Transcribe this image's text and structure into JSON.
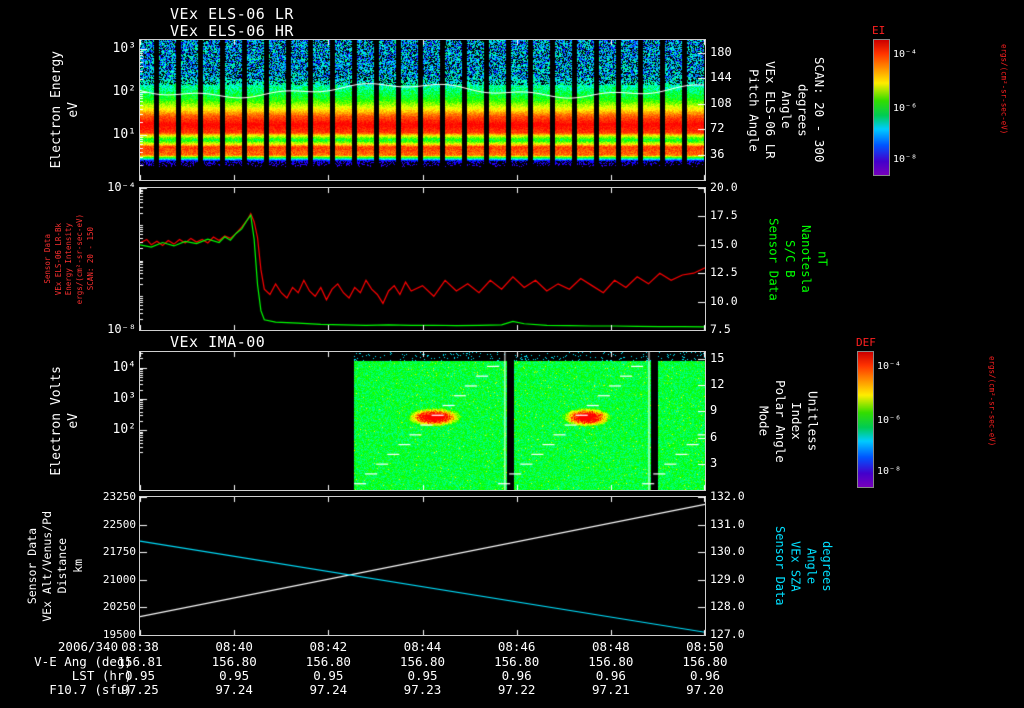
{
  "header": {
    "line1": "VEx ELS-06 LR",
    "line2": "VEx ELS-06 HR"
  },
  "panel3_title": "VEx IMA-00",
  "colors": {
    "background": "#000000",
    "axis": "#ffffff",
    "red_series": "#ff0000",
    "green_series": "#00ff00",
    "cyan_series": "#00e0ff",
    "white_series": "#ffffff",
    "colorbar_title": "#ff2020"
  },
  "time_axis": {
    "date": "2006/340",
    "ticks": [
      "08:38",
      "08:40",
      "08:42",
      "08:44",
      "08:46",
      "08:48",
      "08:50"
    ]
  },
  "footer_rows": [
    {
      "label": "V-E Ang (deg)",
      "values": [
        "156.81",
        "156.80",
        "156.80",
        "156.80",
        "156.80",
        "156.80",
        "156.80"
      ]
    },
    {
      "label": "LST (hr)",
      "values": [
        "0.95",
        "0.95",
        "0.95",
        "0.95",
        "0.96",
        "0.96",
        "0.96"
      ]
    },
    {
      "label": "F10.7 (sfu)",
      "values": [
        "97.25",
        "97.24",
        "97.24",
        "97.23",
        "97.22",
        "97.21",
        "97.20"
      ]
    }
  ],
  "colorbars": [
    {
      "title": "EI",
      "ticks": [
        "10⁻⁴",
        "10⁻⁶",
        "10⁻⁸"
      ],
      "unit": "ergs/(cm²-sr-sec-eV)"
    },
    {
      "title": "DEF",
      "ticks": [
        "10⁻⁴",
        "10⁻⁶",
        "10⁻⁸"
      ],
      "unit": "ergs/(cm²-sr-sec-eV)"
    }
  ],
  "chart_data": [
    {
      "type": "heatmap",
      "name": "els-electron-energy-spectrogram",
      "description": "VEx ELS-06 HR electron energy-time spectrogram 08:38-08:50, intense flux band ~10-60 eV, speckled low flux above 200 eV, regular telemetry gaps",
      "x_range": [
        "08:38",
        "08:50"
      ],
      "left_axis": {
        "label_lines": [
          "Electron Energy",
          "eV"
        ],
        "scale": "log",
        "min": -0.05,
        "max": 3.2,
        "ticks": [
          [
            3,
            "10³"
          ],
          [
            2,
            "10²"
          ],
          [
            1,
            "10¹"
          ]
        ],
        "color": "#ffffff"
      },
      "right_axis": {
        "label_lines": [
          "Pitch Angle",
          "VEx ELS-06 LR",
          "Angle",
          "degrees",
          "SCAN: 20 - 300"
        ],
        "min": 0,
        "max": 198,
        "ticks": [
          [
            180,
            "180"
          ],
          [
            144,
            "144"
          ],
          [
            108,
            "108"
          ],
          [
            72,
            "72"
          ],
          [
            36,
            "36"
          ]
        ],
        "color": "#ffffff"
      },
      "profile": [
        [
          0,
          0.25,
          0.6
        ],
        [
          0.26,
          0.28,
          0.55
        ],
        [
          0.34,
          0.42,
          0.35
        ],
        [
          0.42,
          0.55,
          0.25
        ],
        [
          0.48,
          0.75,
          0.15
        ],
        [
          0.54,
          0.92,
          0.1
        ],
        [
          0.6,
          1.0,
          0.08
        ],
        [
          0.66,
          0.95,
          0.1
        ],
        [
          0.71,
          0.5,
          0.3
        ],
        [
          0.76,
          0.95,
          0.12
        ],
        [
          0.82,
          0.9,
          0.15
        ],
        [
          0.86,
          0.05,
          0.2
        ],
        [
          0.92,
          0,
          0.05
        ],
        [
          1,
          0,
          0
        ]
      ],
      "gaps": {
        "period": 22,
        "width": 5,
        "offset": 8
      },
      "overlay_line": {
        "y_frac": 0.36,
        "color": "#ffffff"
      }
    },
    {
      "type": "line",
      "name": "els-intensity-and-magnetic-field",
      "left_axis": {
        "label_lines": [
          "Sensor Data",
          "VEx ELS-06 LR-Bk",
          "Energy Intensity",
          "ergs/(cm²-sr-sec-eV)",
          "SCAN: 20 - 150"
        ],
        "scale": "log",
        "min": -8,
        "max": -4,
        "ticks": [
          [
            -4,
            "10⁻⁴"
          ],
          [
            -8,
            "10⁻⁸"
          ]
        ],
        "color": "#ff3030"
      },
      "right_axis": {
        "label_lines": [
          "Sensor Data",
          "S/C B",
          "Nanotesla",
          "nT"
        ],
        "min": 7.5,
        "max": 20,
        "ticks": [
          [
            20,
            "20.0"
          ],
          [
            17.5,
            "17.5"
          ],
          [
            15,
            "15.0"
          ],
          [
            12.5,
            "12.5"
          ],
          [
            10,
            "10.0"
          ],
          [
            7.5,
            "7.5"
          ]
        ],
        "color": "#00ff00"
      },
      "series": [
        {
          "name": "energy-intensity-log10",
          "color": "#ff0000",
          "axis": "left",
          "points": [
            [
              0,
              -5.55
            ],
            [
              0.012,
              -5.45
            ],
            [
              0.02,
              -5.6
            ],
            [
              0.03,
              -5.5
            ],
            [
              0.04,
              -5.62
            ],
            [
              0.05,
              -5.48
            ],
            [
              0.06,
              -5.58
            ],
            [
              0.07,
              -5.45
            ],
            [
              0.08,
              -5.55
            ],
            [
              0.09,
              -5.42
            ],
            [
              0.1,
              -5.52
            ],
            [
              0.11,
              -5.45
            ],
            [
              0.12,
              -5.55
            ],
            [
              0.13,
              -5.38
            ],
            [
              0.14,
              -5.48
            ],
            [
              0.15,
              -5.35
            ],
            [
              0.16,
              -5.42
            ],
            [
              0.17,
              -5.28
            ],
            [
              0.18,
              -5.1
            ],
            [
              0.19,
              -4.9
            ],
            [
              0.196,
              -4.72
            ],
            [
              0.202,
              -4.95
            ],
            [
              0.208,
              -5.4
            ],
            [
              0.214,
              -6.3
            ],
            [
              0.22,
              -6.85
            ],
            [
              0.23,
              -7
            ],
            [
              0.24,
              -6.7
            ],
            [
              0.25,
              -6.95
            ],
            [
              0.26,
              -7.1
            ],
            [
              0.27,
              -6.8
            ],
            [
              0.28,
              -6.95
            ],
            [
              0.29,
              -6.6
            ],
            [
              0.3,
              -6.9
            ],
            [
              0.31,
              -7.05
            ],
            [
              0.32,
              -6.8
            ],
            [
              0.33,
              -7.15
            ],
            [
              0.34,
              -6.85
            ],
            [
              0.35,
              -6.7
            ],
            [
              0.36,
              -6.95
            ],
            [
              0.37,
              -7.1
            ],
            [
              0.38,
              -6.8
            ],
            [
              0.39,
              -6.95
            ],
            [
              0.4,
              -6.6
            ],
            [
              0.41,
              -6.85
            ],
            [
              0.42,
              -7
            ],
            [
              0.43,
              -7.25
            ],
            [
              0.44,
              -6.9
            ],
            [
              0.45,
              -6.75
            ],
            [
              0.46,
              -7
            ],
            [
              0.47,
              -6.65
            ],
            [
              0.48,
              -6.9
            ],
            [
              0.5,
              -6.75
            ],
            [
              0.52,
              -7.05
            ],
            [
              0.54,
              -6.6
            ],
            [
              0.56,
              -6.9
            ],
            [
              0.58,
              -6.7
            ],
            [
              0.6,
              -6.95
            ],
            [
              0.62,
              -6.6
            ],
            [
              0.64,
              -6.85
            ],
            [
              0.66,
              -6.5
            ],
            [
              0.68,
              -6.8
            ],
            [
              0.7,
              -6.6
            ],
            [
              0.72,
              -6.9
            ],
            [
              0.74,
              -6.7
            ],
            [
              0.76,
              -6.85
            ],
            [
              0.78,
              -6.55
            ],
            [
              0.8,
              -6.75
            ],
            [
              0.82,
              -6.95
            ],
            [
              0.84,
              -6.6
            ],
            [
              0.86,
              -6.8
            ],
            [
              0.88,
              -6.5
            ],
            [
              0.9,
              -6.7
            ],
            [
              0.92,
              -6.4
            ],
            [
              0.94,
              -6.6
            ],
            [
              0.96,
              -6.45
            ],
            [
              0.98,
              -6.4
            ],
            [
              1,
              -6.25
            ]
          ]
        },
        {
          "name": "sc-magnetic-field-nT",
          "color": "#00ff00",
          "axis": "right",
          "points": [
            [
              0,
              15
            ],
            [
              0.02,
              14.8
            ],
            [
              0.04,
              15.2
            ],
            [
              0.06,
              14.9
            ],
            [
              0.08,
              15.3
            ],
            [
              0.1,
              15.1
            ],
            [
              0.12,
              15.5
            ],
            [
              0.14,
              15.2
            ],
            [
              0.15,
              15.7
            ],
            [
              0.16,
              15.4
            ],
            [
              0.17,
              16
            ],
            [
              0.18,
              16.4
            ],
            [
              0.19,
              17.2
            ],
            [
              0.196,
              17.6
            ],
            [
              0.202,
              15.5
            ],
            [
              0.208,
              11.5
            ],
            [
              0.214,
              9.2
            ],
            [
              0.22,
              8.4
            ],
            [
              0.24,
              8.2
            ],
            [
              0.28,
              8.1
            ],
            [
              0.32,
              8
            ],
            [
              0.36,
              7.95
            ],
            [
              0.4,
              7.9
            ],
            [
              0.44,
              7.95
            ],
            [
              0.48,
              7.9
            ],
            [
              0.52,
              7.92
            ],
            [
              0.56,
              7.88
            ],
            [
              0.6,
              7.9
            ],
            [
              0.64,
              7.95
            ],
            [
              0.66,
              8.25
            ],
            [
              0.68,
              8.05
            ],
            [
              0.72,
              7.9
            ],
            [
              0.76,
              7.88
            ],
            [
              0.8,
              7.85
            ],
            [
              0.84,
              7.85
            ],
            [
              0.88,
              7.82
            ],
            [
              0.92,
              7.8
            ],
            [
              0.96,
              7.8
            ],
            [
              1,
              7.78
            ]
          ]
        }
      ]
    },
    {
      "type": "heatmap",
      "name": "ima-spectrogram",
      "description": "VEx IMA-00 ion spectrogram, data from ~08:42.5 onward, green background with two yellow-red hotspots and white stepped energy-sweep traces",
      "left_axis": {
        "label_lines": [
          "Electron Volts",
          "eV"
        ],
        "scale": "log",
        "min": 0.1,
        "max": 4.5,
        "ticks": [
          [
            4,
            "10⁴"
          ],
          [
            3,
            "10³"
          ],
          [
            2,
            "10²"
          ]
        ],
        "color": "#ffffff"
      },
      "right_axis": {
        "label_lines": [
          "Mode",
          "Polar Angle",
          "Index",
          "Unitless"
        ],
        "min": 0,
        "max": 15.8,
        "ticks": [
          [
            15,
            "15"
          ],
          [
            12,
            "12"
          ],
          [
            9,
            "9"
          ],
          [
            6,
            "6"
          ],
          [
            3,
            "3"
          ]
        ],
        "color": "#ffffff"
      },
      "data_start_frac": 0.38,
      "base_intensity": 0.5,
      "hotspots": [
        {
          "x": 0.52,
          "y": 0.47,
          "rx": 0.05,
          "ry": 0.07
        },
        {
          "x": 0.79,
          "y": 0.47,
          "rx": 0.045,
          "ry": 0.07
        }
      ],
      "sweep_lines": {
        "period_frac": 0.255,
        "y_top": 0.1,
        "y_bottom": 0.95,
        "color": "#ffffff"
      },
      "dividers": [
        0.645,
        0.9
      ]
    },
    {
      "type": "line",
      "name": "altitude-and-sza",
      "left_axis": {
        "label_lines": [
          "Sensor Data",
          "VEx Alt/Venus/Pd",
          "Distance",
          "km"
        ],
        "min": 19500,
        "max": 23250,
        "ticks": [
          [
            23250,
            "23250"
          ],
          [
            22500,
            "22500"
          ],
          [
            21750,
            "21750"
          ],
          [
            21000,
            "21000"
          ],
          [
            20250,
            "20250"
          ],
          [
            19500,
            "19500"
          ]
        ],
        "color": "#ffffff"
      },
      "right_axis": {
        "label_lines": [
          "Sensor Data",
          "VEx SZA",
          "Angle",
          "degrees"
        ],
        "min": 127,
        "max": 132,
        "ticks": [
          [
            132,
            "132.0"
          ],
          [
            131,
            "131.0"
          ],
          [
            130,
            "130.0"
          ],
          [
            129,
            "129.0"
          ],
          [
            128,
            "128.0"
          ],
          [
            127,
            "127.0"
          ]
        ],
        "color": "#00e0ff"
      },
      "series": [
        {
          "name": "vex-altitude-km",
          "color": "#ffffff",
          "axis": "left",
          "points": [
            [
              0,
              20000
            ],
            [
              1,
              23050
            ]
          ]
        },
        {
          "name": "vex-sza-deg",
          "color": "#00e0ff",
          "axis": "right",
          "points": [
            [
              0,
              130.4
            ],
            [
              1,
              127.1
            ]
          ]
        }
      ]
    }
  ]
}
